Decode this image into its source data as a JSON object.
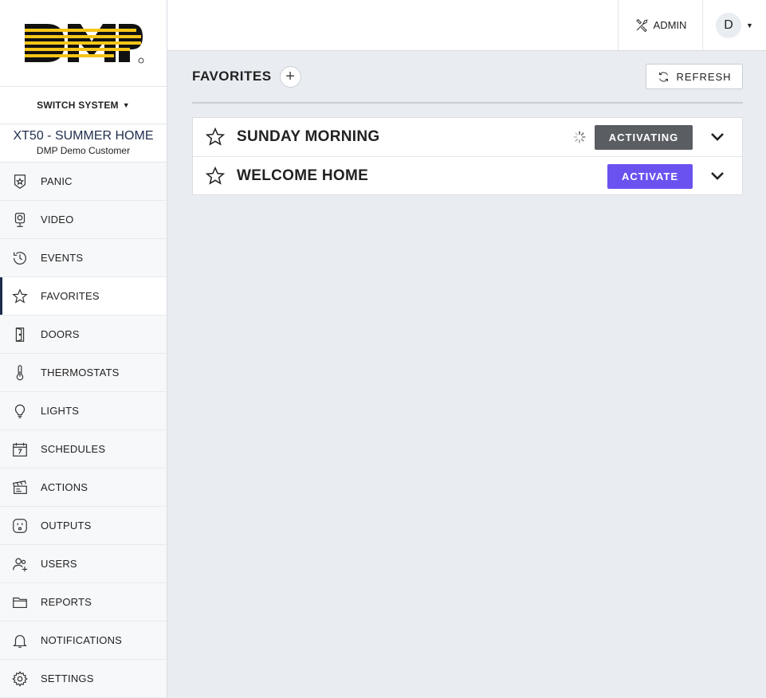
{
  "brand": {
    "logo_text": "DMP"
  },
  "sidebar": {
    "switch_system_label": "SWITCH SYSTEM",
    "system_name": "XT50 - SUMMER HOME",
    "customer_name": "DMP Demo Customer",
    "items": [
      {
        "label": "PANIC",
        "icon": "panic-badge-icon"
      },
      {
        "label": "VIDEO",
        "icon": "camera-icon"
      },
      {
        "label": "EVENTS",
        "icon": "history-icon"
      },
      {
        "label": "FAVORITES",
        "icon": "star-icon",
        "active": true
      },
      {
        "label": "DOORS",
        "icon": "door-icon"
      },
      {
        "label": "THERMOSTATS",
        "icon": "thermometer-icon"
      },
      {
        "label": "LIGHTS",
        "icon": "lightbulb-icon"
      },
      {
        "label": "SCHEDULES",
        "icon": "calendar-icon"
      },
      {
        "label": "ACTIONS",
        "icon": "clapperboard-icon"
      },
      {
        "label": "OUTPUTS",
        "icon": "outlet-icon"
      },
      {
        "label": "USERS",
        "icon": "users-icon"
      },
      {
        "label": "REPORTS",
        "icon": "folder-icon"
      },
      {
        "label": "NOTIFICATIONS",
        "icon": "bell-icon"
      },
      {
        "label": "SETTINGS",
        "icon": "gear-icon"
      }
    ]
  },
  "topbar": {
    "admin_label": "ADMIN",
    "user_initial": "D"
  },
  "main": {
    "title": "FAVORITES",
    "add_label": "+",
    "refresh_label": "REFRESH",
    "favorites": [
      {
        "name": "SUNDAY MORNING",
        "button": "ACTIVATING",
        "state": "activating"
      },
      {
        "name": "WELCOME HOME",
        "button": "ACTIVATE",
        "state": "idle"
      }
    ]
  },
  "colors": {
    "accent": "#6a52f0",
    "activating": "#5a5e63",
    "logo_yellow": "#f5c518",
    "nav_active_bar": "#1f2d4d",
    "background": "#e9ecf1"
  }
}
